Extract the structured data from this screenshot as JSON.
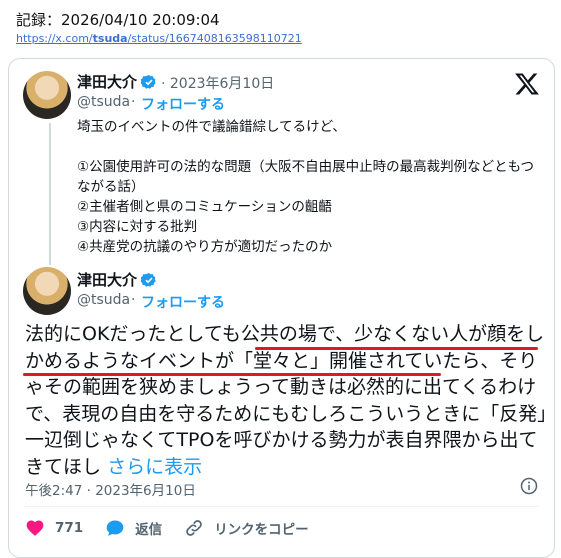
{
  "record": {
    "label": "記録：2026/04/10 20:09:04",
    "url_prefix": "https://x.com/",
    "url_user": "tsuda",
    "url_suffix": "/status/1667408163598110721"
  },
  "quoted_tweet": {
    "name": "津田大介",
    "handle": "@tsuda",
    "date": "· 2023年6月10日",
    "follow": "フォローする",
    "text": "埼玉のイベントの件で議論錯綜してるけど、\n\n①公園使用許可の法的な問題（大阪不自由展中止時の最高裁判例などともつながる話）\n②主催者側と県のコミュケーションの齟齬\n③内容に対する批判\n④共産党の抗議のやり方が適切だったのか"
  },
  "main_tweet": {
    "name": "津田大介",
    "handle": "@tsuda",
    "follow": "フォローする",
    "text": "法的にOKだったとしても公共の場で、少なくない人が顔をしかめるようなイベントが「堂々と」開催されていたら、そりゃその範囲を狭めましょうって動きは必然的に出てくるわけで、表現の自由を守るためにもむしろこういうときに「反発」一辺倒じゃなくてTPOを呼びかける勢力が表自界隈から出てきてほし",
    "show_more": "さらに表示",
    "timestamp": "午後2:47 · 2023年6月10日"
  },
  "actions": {
    "like_count": "771",
    "reply_label": "返信",
    "copy_link_label": "リンクをコピー"
  },
  "colors": {
    "accent": "#1d9bf0",
    "like": "#f91880",
    "highlight_underline": "#d91b24"
  },
  "icons": [
    "verified-badge-icon",
    "x-logo-icon",
    "info-icon",
    "heart-icon",
    "reply-bubble-icon",
    "link-icon"
  ]
}
